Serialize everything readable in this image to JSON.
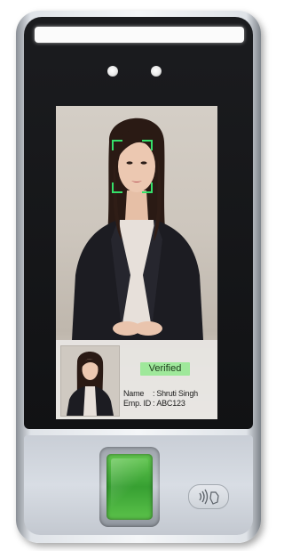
{
  "device": {
    "verification": {
      "status_label": "Verified",
      "name_label": "Name",
      "name_value": "Shruti Singh",
      "emp_id_label": "Emp. ID",
      "emp_id_value": "ABC123",
      "separator": ":"
    },
    "icons": {
      "face_frame": "face-detect-frame-icon",
      "contactless": "nfc-contactless-icon",
      "fingerprint": "fingerprint-sensor"
    },
    "colors": {
      "face_frame": "#35e06a",
      "verified_badge": "#9fe89b",
      "fingerprint_sensor": "#46b23c",
      "light_bar": "#fbfbfb"
    }
  }
}
